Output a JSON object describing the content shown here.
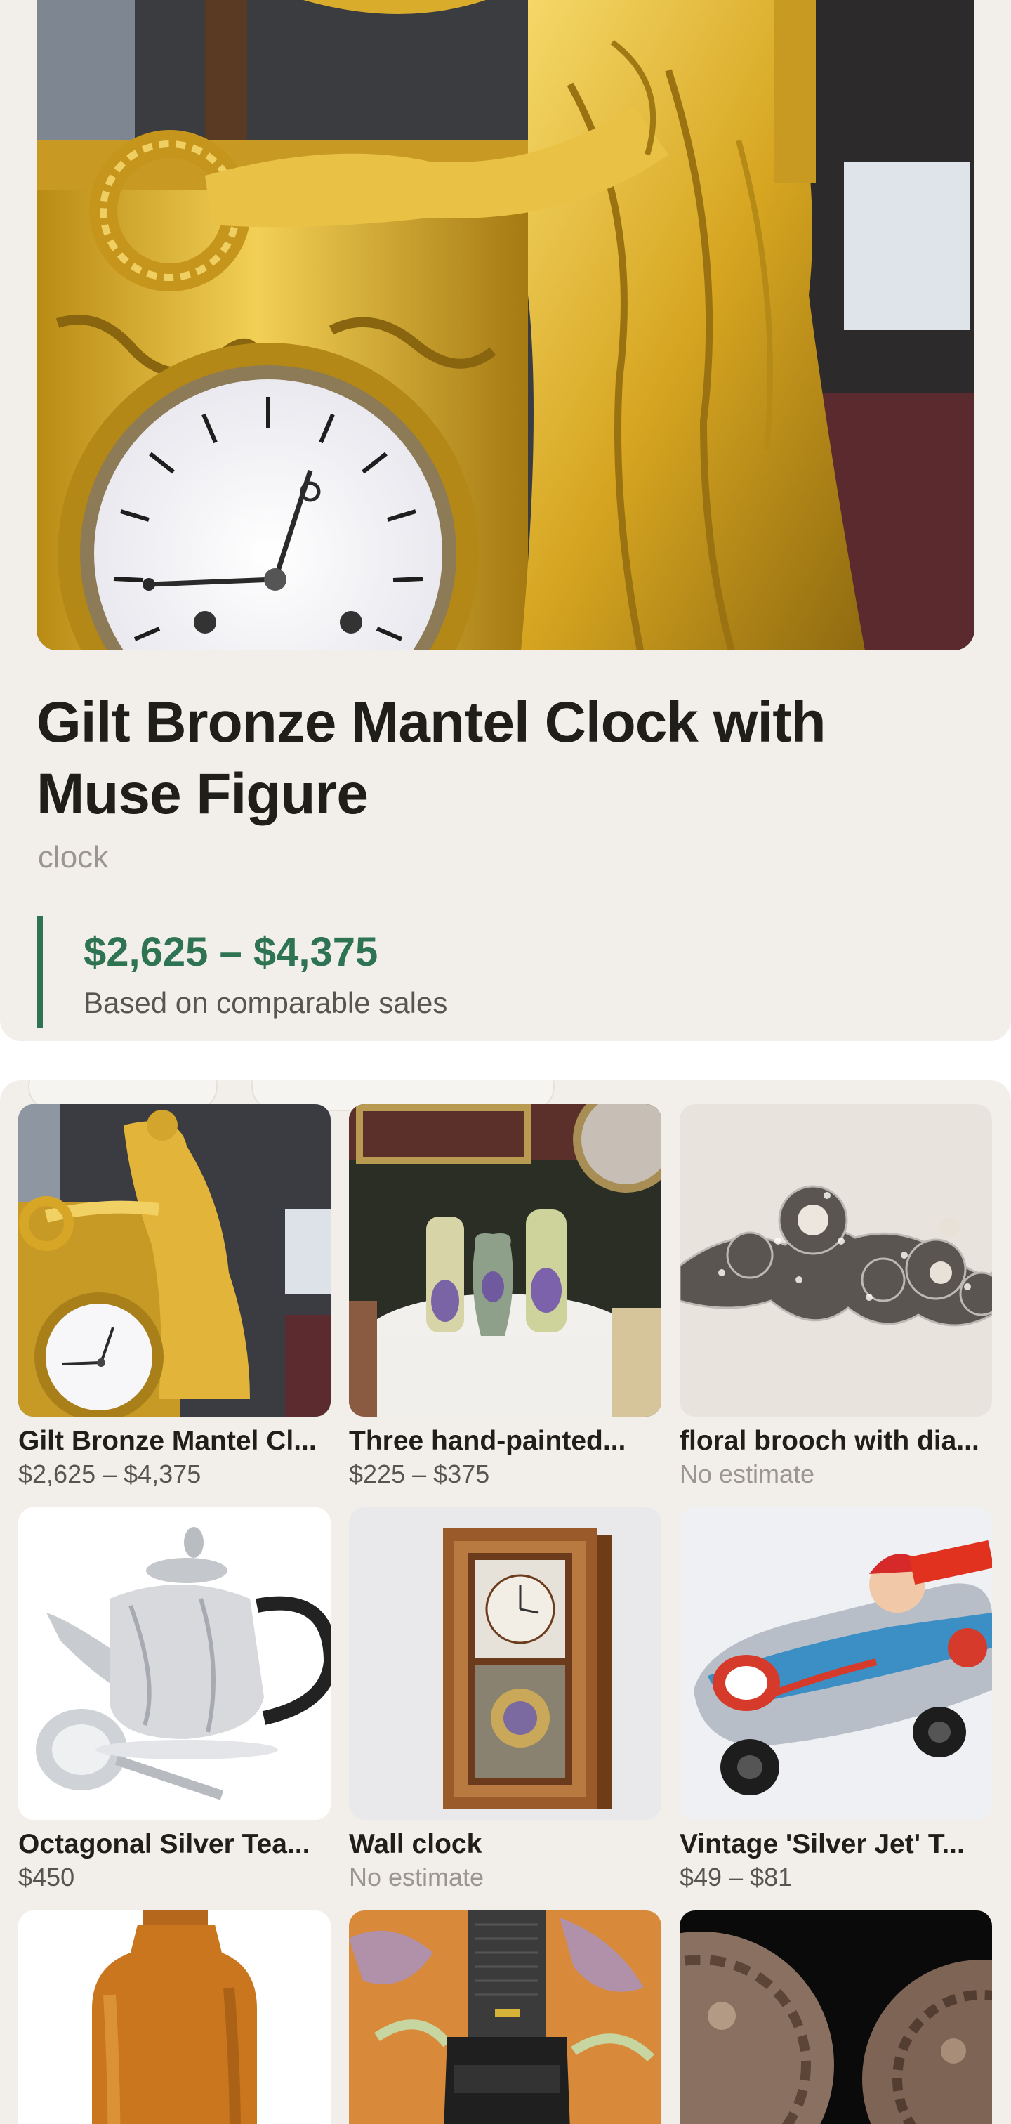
{
  "detail": {
    "title": "Gilt Bronze Mantel Clock with Muse Figure",
    "category": "clock",
    "estimate": {
      "range": "$2,625 – $4,375",
      "caption": "Based on comparable sales"
    }
  },
  "similar": {
    "items": [
      {
        "title": "Gilt Bronze Mantel Cl...",
        "price": "$2,625 – $4,375"
      },
      {
        "title": "Three hand-painted...",
        "price": "$225 – $375"
      },
      {
        "title": "floral brooch with dia...",
        "price": "No estimate"
      },
      {
        "title": "Octagonal Silver Tea...",
        "price": "$450"
      },
      {
        "title": "Wall clock",
        "price": "No estimate"
      },
      {
        "title": "Vintage 'Silver Jet' T...",
        "price": "$49 – $81"
      }
    ]
  },
  "colors": {
    "background": "#f2efeb",
    "accent_green": "#2f7452",
    "text_primary": "#201e1b",
    "text_muted": "#9b968f"
  }
}
